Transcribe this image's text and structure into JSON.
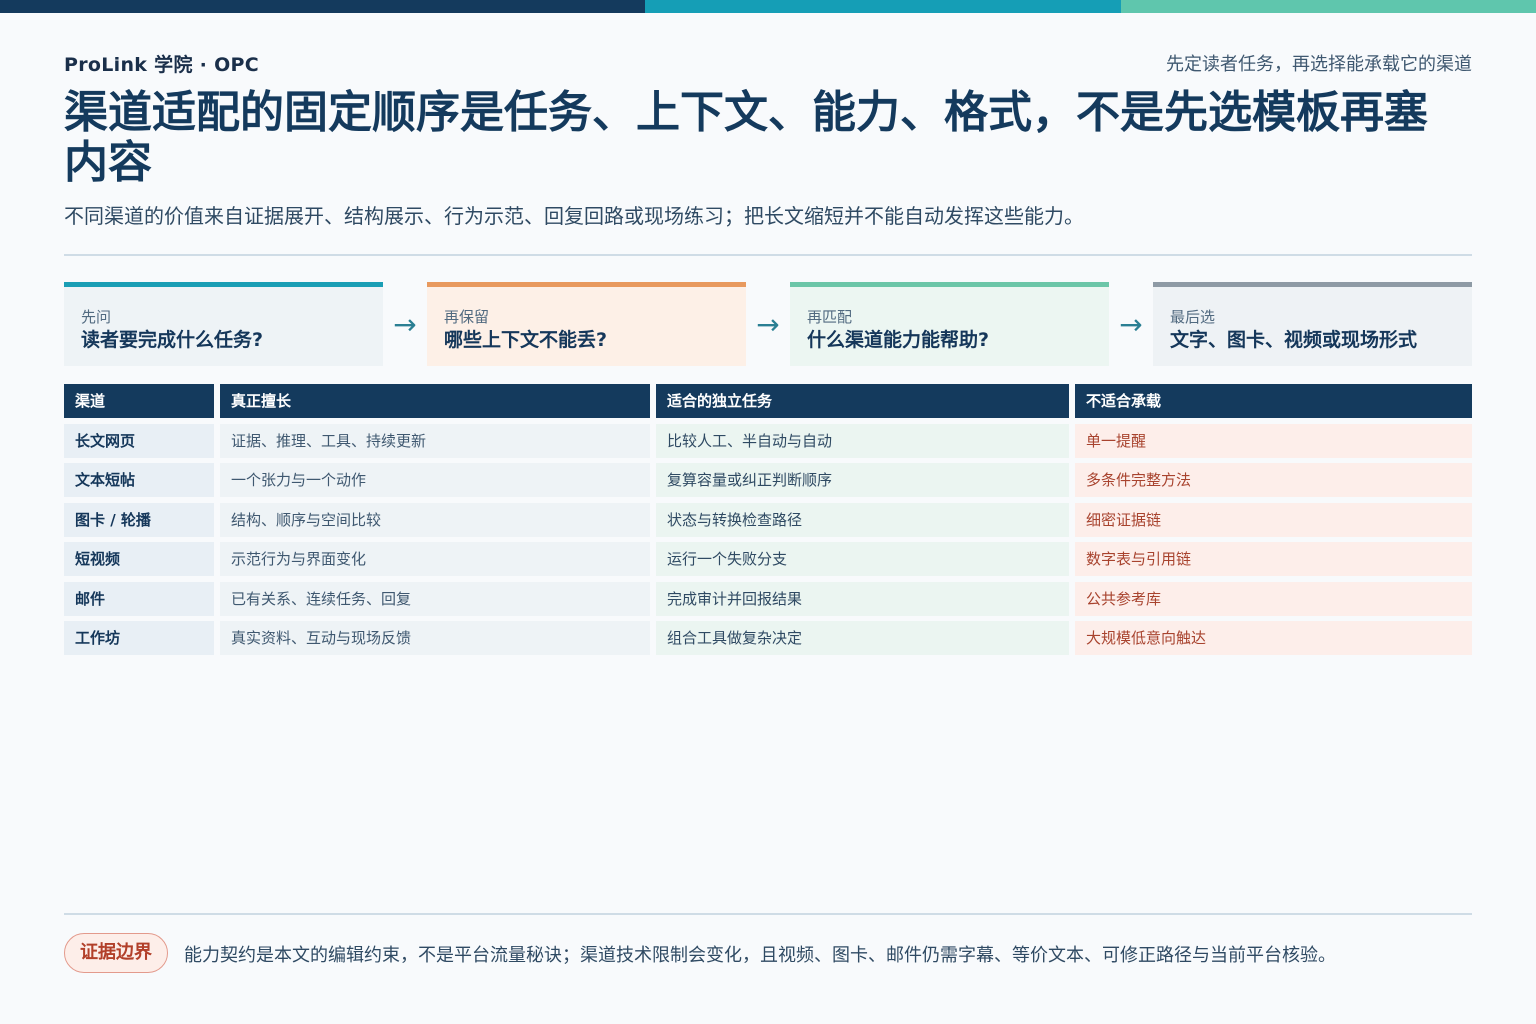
{
  "header": {
    "brand": "ProLink 学院 · OPC",
    "tagline": "先定读者任务，再选择能承载它的渠道",
    "title": "渠道适配的固定顺序是任务、上下文、能力、格式，不是先选模板再塞内容",
    "subtitle": "不同渠道的价值来自证据展开、结构展示、行为示范、回复回路或现场练习；把长文缩短并不能自动发挥这些能力。"
  },
  "steps": [
    {
      "small": "先问",
      "big": "读者要完成什么任务?"
    },
    {
      "small": "再保留",
      "big": "哪些上下文不能丢?"
    },
    {
      "small": "再匹配",
      "big": "什么渠道能力能帮助?"
    },
    {
      "small": "最后选",
      "big": "文字、图卡、视频或现场形式"
    }
  ],
  "arrow_glyph": "→",
  "table": {
    "headers": [
      "渠道",
      "真正擅长",
      "适合的独立任务",
      "不适合承载"
    ],
    "rows": [
      [
        "长文网页",
        "证据、推理、工具、持续更新",
        "比较人工、半自动与自动",
        "单一提醒"
      ],
      [
        "文本短帖",
        "一个张力与一个动作",
        "复算容量或纠正判断顺序",
        "多条件完整方法"
      ],
      [
        "图卡 / 轮播",
        "结构、顺序与空间比较",
        "状态与转换检查路径",
        "细密证据链"
      ],
      [
        "短视频",
        "示范行为与界面变化",
        "运行一个失败分支",
        "数字表与引用链"
      ],
      [
        "邮件",
        "已有关系、连续任务、回复",
        "完成审计并回报结果",
        "公共参考库"
      ],
      [
        "工作坊",
        "真实资料、互动与现场反馈",
        "组合工具做复杂决定",
        "大规模低意向触达"
      ]
    ]
  },
  "footer": {
    "badge": "证据边界",
    "note": "能力契约是本文的编辑约束，不是平台流量秘诀；渠道技术限制会变化，且视频、图卡、邮件仍需字幕、等价文本、可修正路径与当前平台核验。"
  },
  "colors": {
    "navy": "#143a5d",
    "teal": "#159eb6",
    "mint": "#5fc6ad",
    "orange": "#e8995e",
    "gray": "#8e9aa5",
    "red": "#b2402a"
  }
}
